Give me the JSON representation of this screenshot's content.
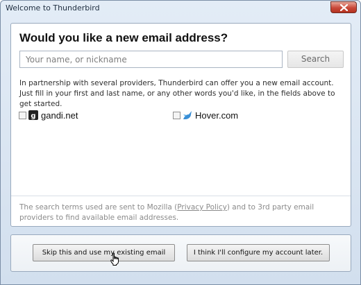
{
  "window": {
    "title": "Welcome to Thunderbird"
  },
  "icons": {
    "close": "close-x-icon",
    "gandi": "gandi-icon",
    "hover": "hover-bird-icon",
    "cursor": "hand-pointer-icon"
  },
  "colors": {
    "close_button": "#c9493a",
    "panel_border": "#98a9bd"
  },
  "main": {
    "heading": "Would you like a new email address?",
    "search": {
      "placeholder": "Your name, or nickname",
      "value": "",
      "button_label": "Search"
    },
    "description": "In partnership with several providers, Thunderbird can offer you a new email account. Just fill in your first and last name, or any other words you'd like, in the fields above to get started.",
    "providers": [
      {
        "name": "gandi.net",
        "checked": false
      },
      {
        "name": "Hover.com",
        "checked": false
      }
    ],
    "footer": {
      "before_link": "The search terms used are sent to Mozilla (",
      "link": "Privacy Policy",
      "after_link": ") and to 3rd party email providers to find available email addresses."
    }
  },
  "buttons": {
    "skip": "Skip this and use my existing email",
    "later": "I think I'll configure my account later."
  }
}
